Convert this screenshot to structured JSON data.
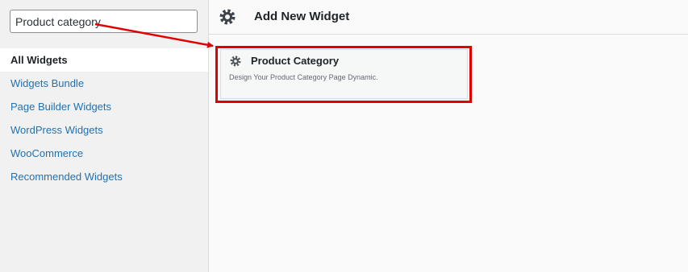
{
  "search": {
    "value": "Product category"
  },
  "sidebar": {
    "items": [
      {
        "label": "All Widgets",
        "active": true
      },
      {
        "label": "Widgets Bundle"
      },
      {
        "label": "Page Builder Widgets"
      },
      {
        "label": "WordPress Widgets"
      },
      {
        "label": "WooCommerce"
      },
      {
        "label": "Recommended Widgets"
      }
    ]
  },
  "header": {
    "title": "Add New Widget",
    "icon": "gear-icon"
  },
  "widget": {
    "title": "Product Category",
    "description": "Design Your Product Category Page Dynamic.",
    "icon": "gear-icon"
  },
  "annotation": {
    "color": "#e00000"
  },
  "colors": {
    "link": "#2271b1",
    "active_text": "#1d2327"
  }
}
